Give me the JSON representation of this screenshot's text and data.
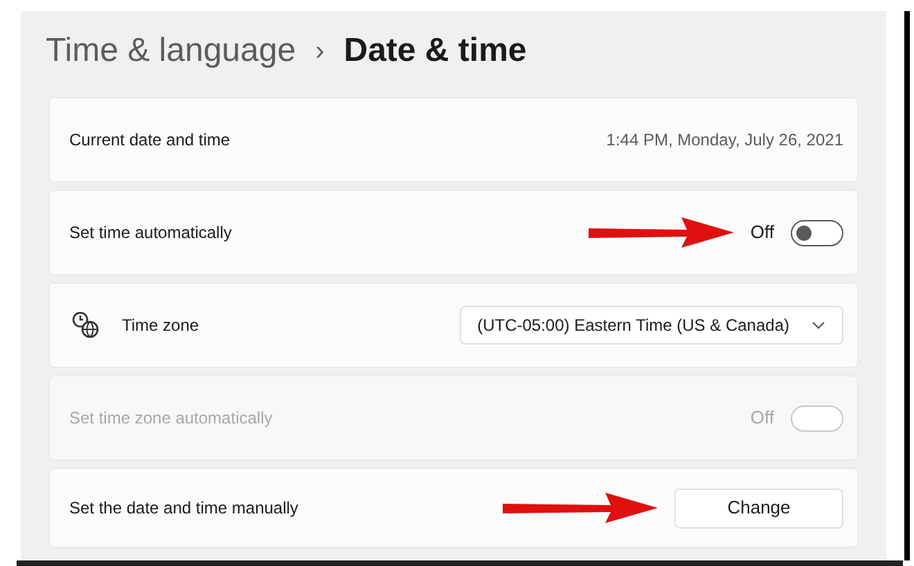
{
  "breadcrumb": {
    "parent": "Time & language",
    "separator": "›",
    "current": "Date & time"
  },
  "rows": [
    {
      "kind": "info",
      "label": "Current date and time",
      "value": "1:44 PM, Monday, July 26, 2021",
      "disabled": false,
      "arrow": false
    },
    {
      "kind": "toggle",
      "label": "Set time automatically",
      "value": "Off",
      "on": false,
      "disabled": false,
      "arrow": true
    },
    {
      "kind": "dropdown",
      "label": "Time zone",
      "value": "(UTC-05:00) Eastern Time (US & Canada)",
      "disabled": false,
      "arrow": false
    },
    {
      "kind": "toggle",
      "label": "Set time zone automatically",
      "value": "Off",
      "on": false,
      "disabled": true,
      "arrow": false
    },
    {
      "kind": "button",
      "label": "Set the date and time manually",
      "value": "Change",
      "disabled": false,
      "arrow": true
    }
  ]
}
